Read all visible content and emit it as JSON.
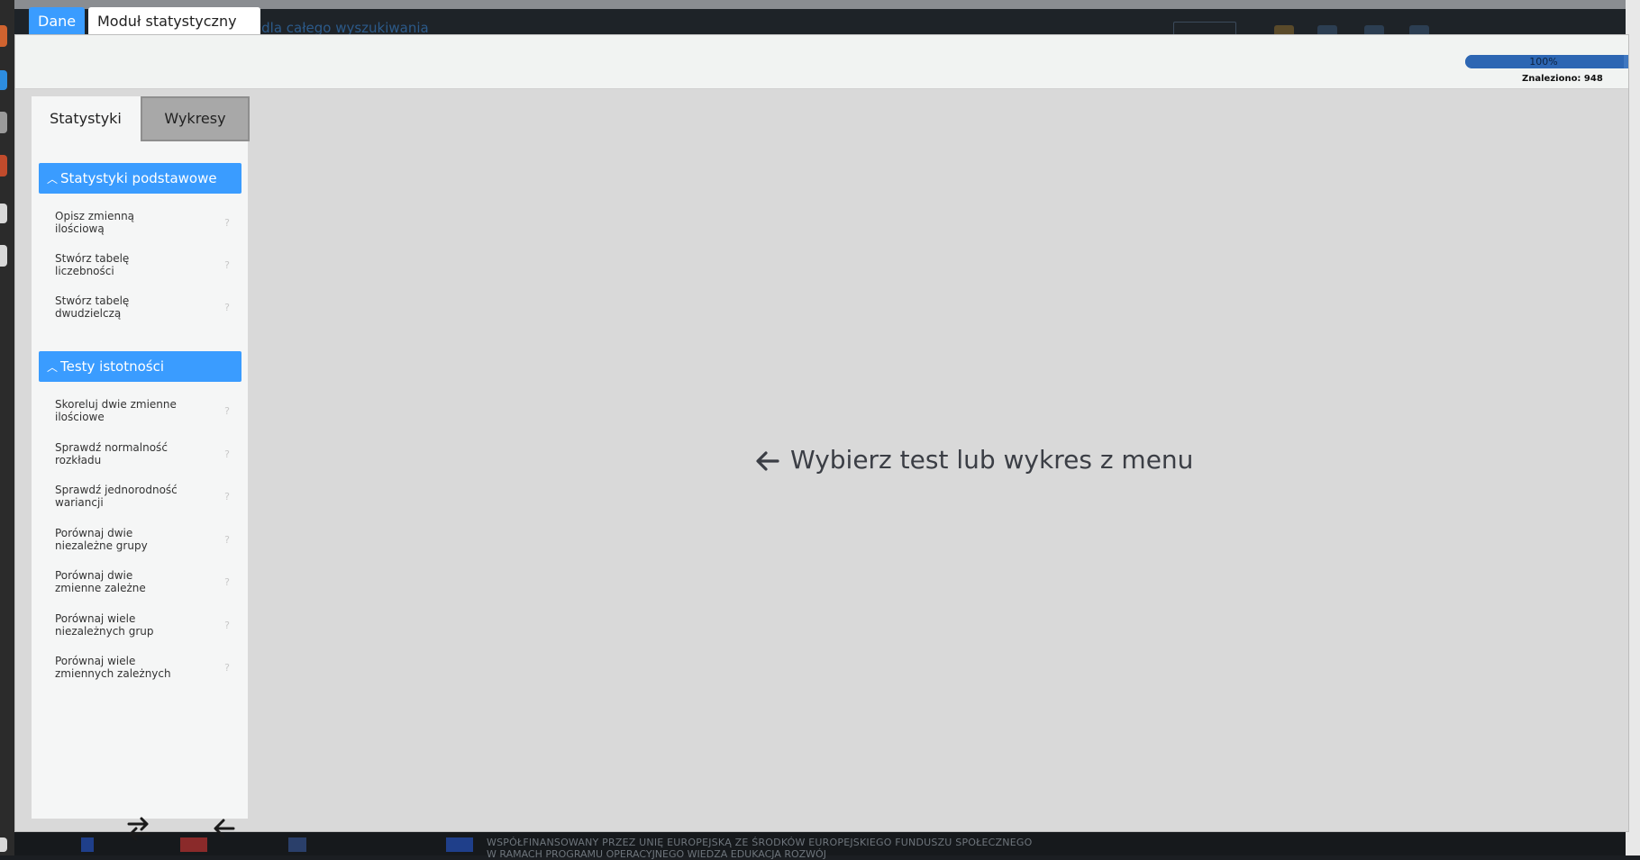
{
  "background": {
    "search_hint": "ut dla całego wyszukiwania",
    "footer_line1": "WSPÓŁFINANSOWANY PRZEZ UNIĘ EUROPEJSKĄ ZE ŚRODKÓW EUROPEJSKIEGO FUNDUSZU SPOŁECZNEGO",
    "footer_line2": "W RAMACH PROGRAMU OPERACYJNEGO WIEDZA EDUKACJA ROZWÓJ"
  },
  "modal": {
    "tabs": [
      {
        "label": "Dane",
        "active": false
      },
      {
        "label": "Moduł statystyczny",
        "active": true
      }
    ],
    "progress": {
      "text": "100%",
      "fraction": 0.97
    },
    "found_text": "Znaleziono: 948"
  },
  "sidebar": {
    "tabs": [
      {
        "label": "Statystyki",
        "active": true
      },
      {
        "label": "Wykresy",
        "active": false
      }
    ],
    "sections": [
      {
        "title": "Statystyki podstawowe",
        "items": [
          {
            "line1": "Opisz zmienną",
            "line2": "ilościową"
          },
          {
            "line1": "Stwórz tabelę",
            "line2": "liczebności"
          },
          {
            "line1": "Stwórz tabelę",
            "line2": "dwudzielczą"
          }
        ]
      },
      {
        "title": "Testy istotności",
        "items": [
          {
            "line1": "Skoreluj dwie zmienne",
            "line2": "ilościowe"
          },
          {
            "line1": "Sprawdź normalność",
            "line2": "rozkładu"
          },
          {
            "line1": "Sprawdź jednorodność",
            "line2": "wariancji"
          },
          {
            "line1": "Porównaj dwie",
            "line2": "niezależne grupy"
          },
          {
            "line1": "Porównaj dwie",
            "line2": "zmienne zależne"
          },
          {
            "line1": "Porównaj wiele",
            "line2": "niezależnych grup"
          },
          {
            "line1": "Porównaj wiele",
            "line2": "zmiennych zależnych"
          }
        ]
      }
    ],
    "help_glyph": "?",
    "footer_icons": [
      "swap-icon",
      "arrow-left-icon"
    ]
  },
  "main": {
    "placeholder": "Wybierz test lub wykres z menu",
    "placeholder_icon": "arrow-left-icon"
  },
  "colors": {
    "accent": "#3a9cff",
    "progress": "#2d66b3",
    "modal_bg": "#d9d9d9",
    "sidebar_bg": "#f5f6f6",
    "inactive_tab": "#a8a8a8"
  }
}
